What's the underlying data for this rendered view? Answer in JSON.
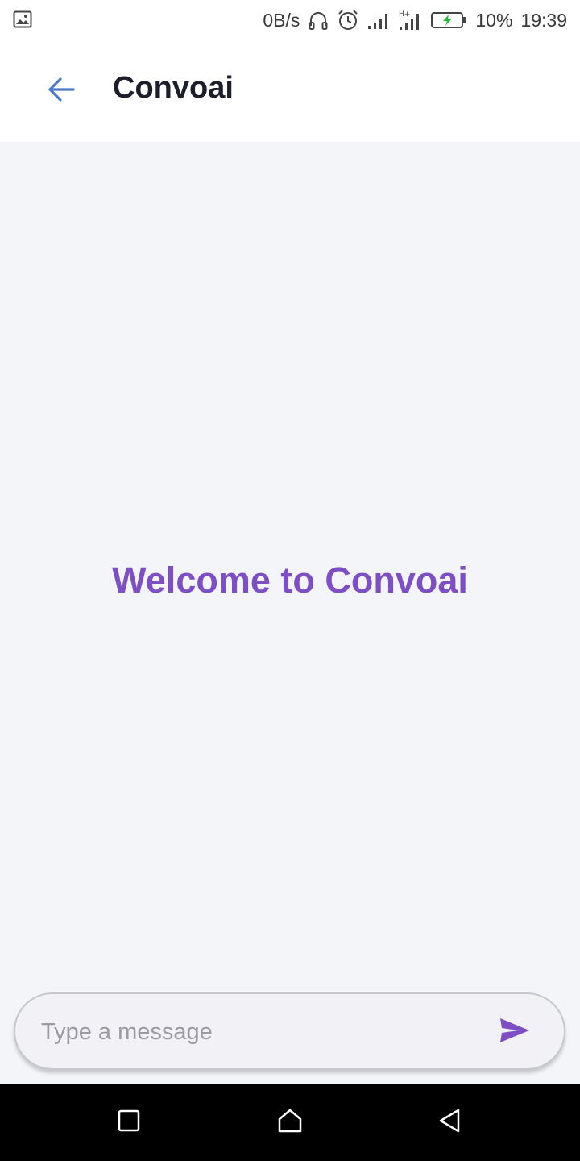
{
  "status_bar": {
    "left_icon": "image-notification-icon",
    "net_speed": "0B/s",
    "icons": [
      "headset-icon",
      "alarm-icon",
      "signal-icon",
      "signal-hplus-icon",
      "battery-charging-icon"
    ],
    "battery": "10%",
    "time": "19:39"
  },
  "app_bar": {
    "back_icon": "arrow-left-icon",
    "title": "Convoai"
  },
  "main": {
    "welcome_text": "Welcome to Convoai"
  },
  "composer": {
    "placeholder": "Type a message",
    "value": "",
    "send_icon": "send-icon"
  },
  "nav_bar": {
    "icons": [
      "recents-square-icon",
      "home-icon",
      "back-triangle-icon"
    ]
  },
  "colors": {
    "accent": "#7e4fc4",
    "back_arrow": "#4a78c8",
    "title": "#1c1f2a",
    "content_bg": "#f4f5f9",
    "battery_bolt": "#22b83a"
  }
}
